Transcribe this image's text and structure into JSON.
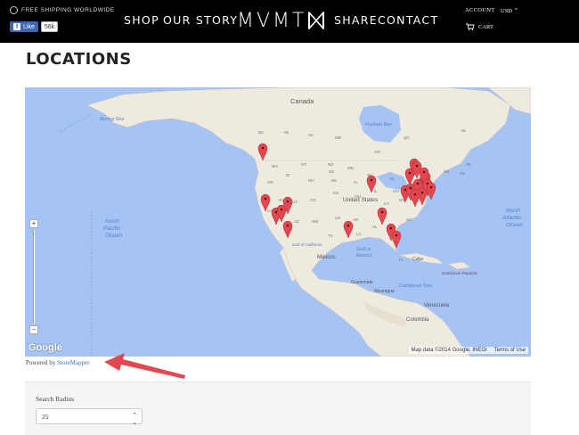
{
  "header": {
    "shipping": "FREE SHIPPING WORLDWIDE",
    "fb_like": "Like",
    "fb_count": "56k",
    "nav_left": [
      "SHOP",
      "OUR STORY"
    ],
    "logo": "MVMT",
    "nav_right": [
      "SHARE",
      "CONTACT"
    ],
    "account": "ACCOUNT",
    "currency": "USD",
    "cart": "CART"
  },
  "page": {
    "title": "LOCATIONS"
  },
  "map": {
    "labels": {
      "canada": "Canada",
      "us": "United States",
      "mexico": "Mexico",
      "gulf1": "Gulf of",
      "gulf2": "Mexico",
      "nph1": "North",
      "nph2": "Pacific",
      "nph3": "Ocean",
      "nat1": "North",
      "nat2": "Atlantic",
      "nat3": "Ocean",
      "bering": "Bering Sea",
      "hudson": "Hudson Bay",
      "venezuela": "Venezuela",
      "colombia": "Colombia",
      "cuba": "Cuba",
      "guatemala": "Guatemala",
      "nicaragua": "Nicaragua",
      "caribbean": "Caribbean Sea",
      "dr": "Dominican Republic",
      "gulf_cal": "Gulf of California",
      "states": [
        "BC",
        "AB",
        "SK",
        "MB",
        "ON",
        "QC",
        "NL",
        "WA",
        "OR",
        "ID",
        "MT",
        "ND",
        "MN",
        "WI",
        "MI",
        "NY",
        "CA",
        "NV",
        "UT",
        "CO",
        "KS",
        "MO",
        "IL",
        "OH",
        "PA",
        "AZ",
        "NM",
        "OK",
        "AR",
        "TN",
        "TX",
        "LA",
        "AL",
        "GA",
        "SC",
        "FL",
        "VA",
        "WV",
        "KY",
        "IA",
        "NE",
        "SD",
        "WY",
        "NS",
        "NB",
        "PE"
      ]
    },
    "attribution": "Map data ©2014 Google, INEGI",
    "terms": "Terms of Use",
    "google": "Google",
    "zoom_in": "+",
    "zoom_out": "−"
  },
  "powered_by": {
    "prefix": "Powered by",
    "link": "StoreMapper"
  },
  "search": {
    "radius_label": "Search Radius",
    "radius_value": "25"
  },
  "colors": {
    "header_bg": "#000000",
    "ocean": "#a5c3f5",
    "land": "#efeadf",
    "marker": "#e4484f",
    "arrow": "#e4484f"
  }
}
